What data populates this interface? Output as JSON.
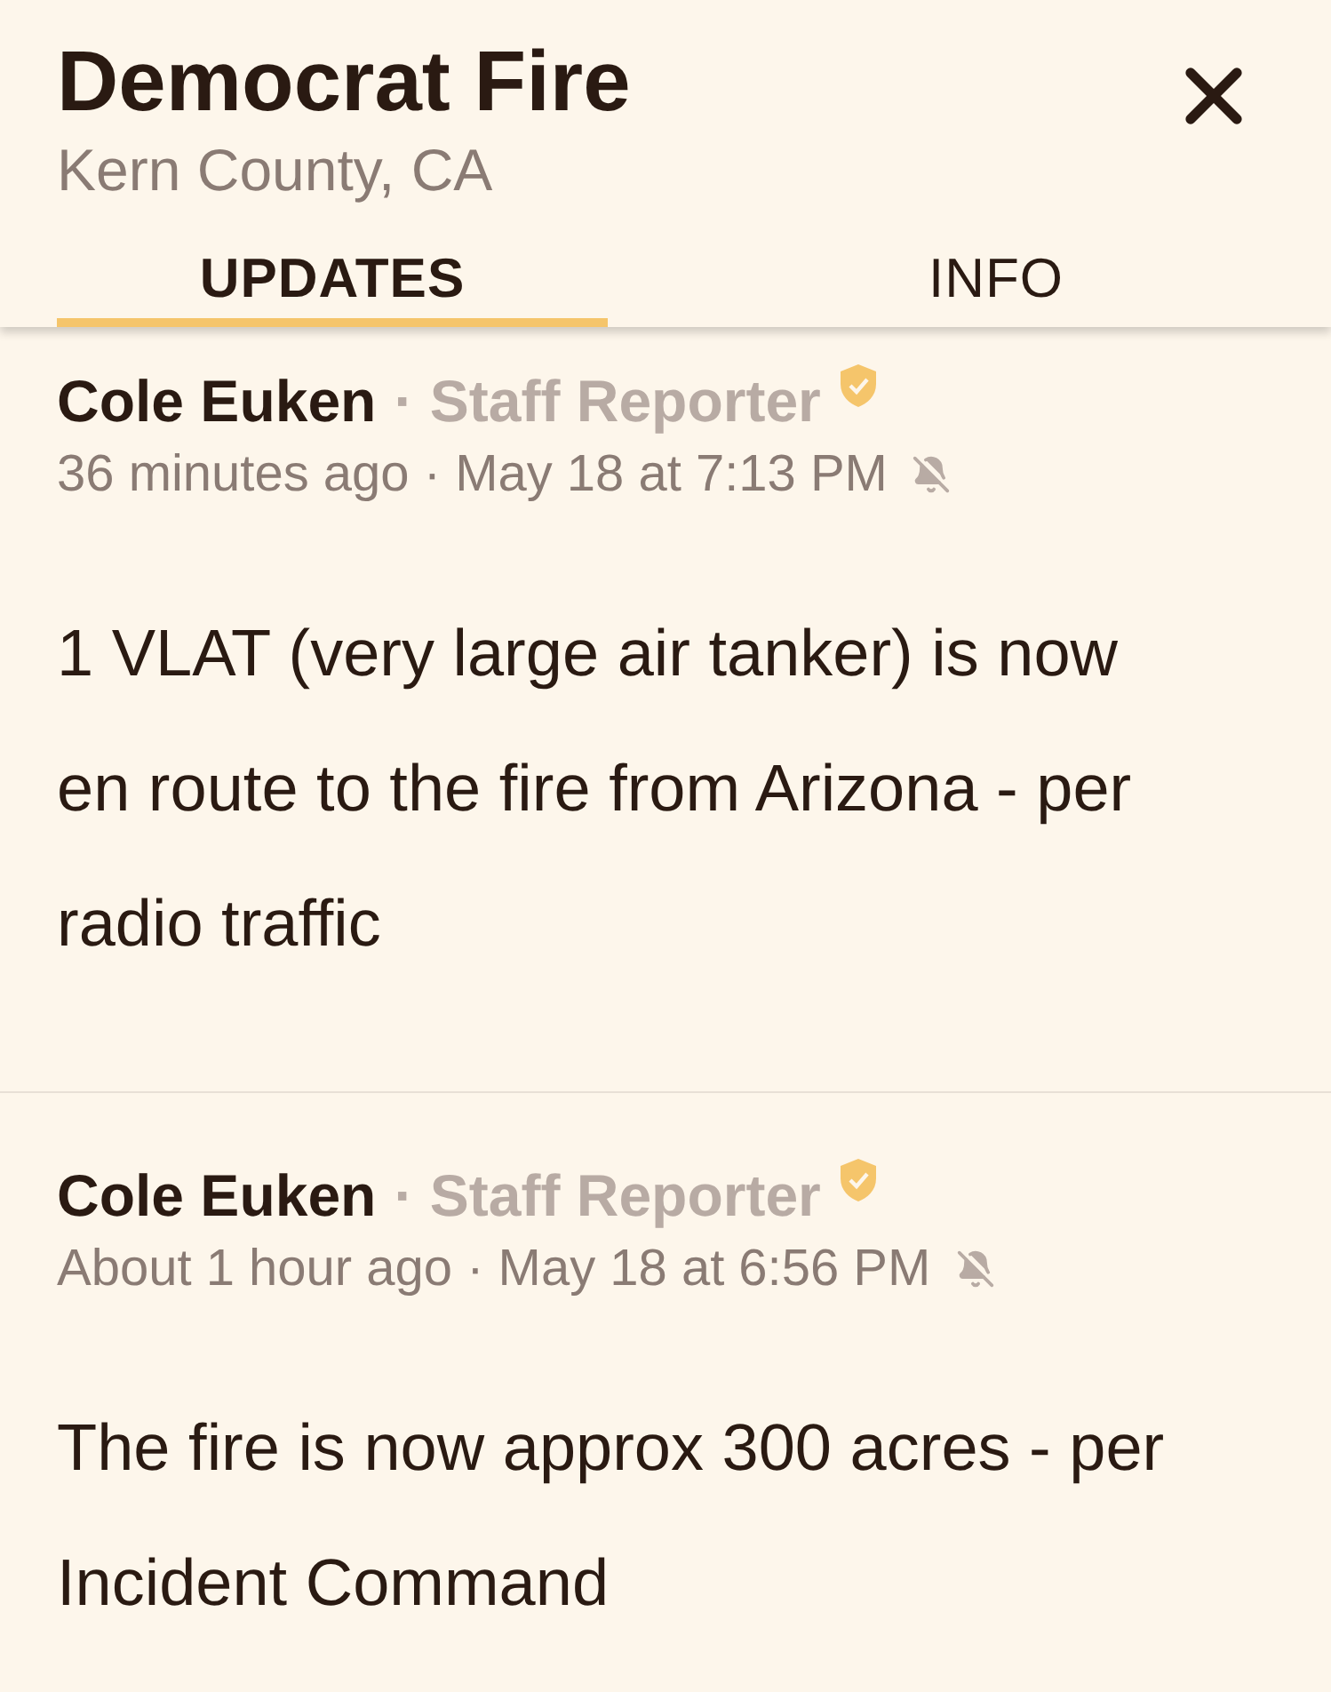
{
  "header": {
    "title": "Democrat Fire",
    "subtitle": "Kern County, CA"
  },
  "tabs": [
    {
      "label": "UPDATES",
      "selected": true
    },
    {
      "label": "INFO",
      "selected": false
    }
  ],
  "posts": [
    {
      "author": "Cole Euken",
      "role": "· Staff Reporter",
      "verified": true,
      "time": "36 minutes ago · May 18 at 7:13 PM",
      "notified": false,
      "body": "1 VLAT (very large air tanker) is now en route to the fire from Arizona - per radio traffic"
    },
    {
      "author": "Cole Euken",
      "role": "· Staff Reporter",
      "verified": true,
      "time": "About 1 hour ago · May 18 at 6:56 PM",
      "notified": false,
      "body": "The fire is now approx 300 acres - per Incident Command"
    }
  ]
}
